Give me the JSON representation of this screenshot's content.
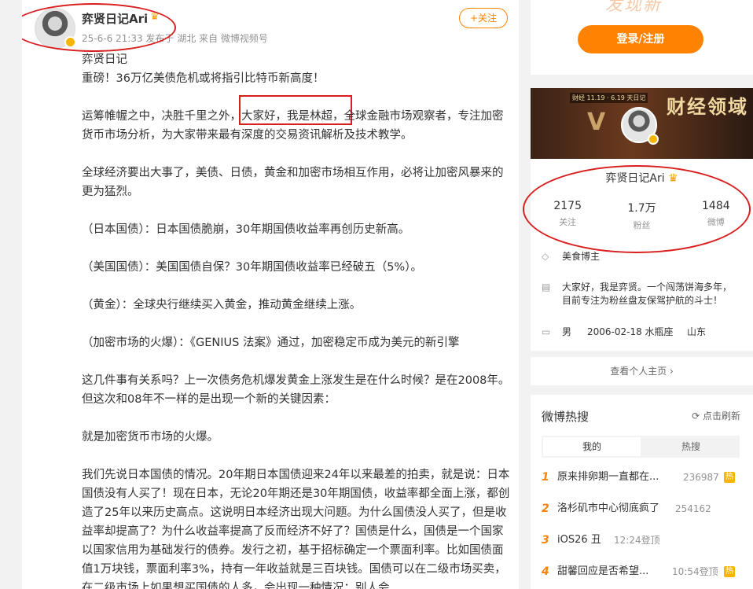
{
  "post": {
    "author": "弈贤日记Ari",
    "meta": "25-6-6 21:33  发布于 湖北  来自 微博视频号",
    "follow_label": "+关注",
    "paragraphs": [
      "弈贤日记",
      "重磅！36万亿美债危机或将指引比特币新高度！",
      "",
      "运筹帷幄之中，决胜千里之外，大家好，我是林超，全球金融市场观察者，专注加密货币市场分析，为大家带来最有深度的交易资讯解析及技术教学。",
      "",
      "全球经济要出大事了，美债、日债，黄金和加密市场相互作用，必将让加密风暴来的更为猛烈。",
      "",
      "（日本国债）：日本国债脆崩，30年期国债收益率再创历史新高。",
      "",
      "（美国国债）：美国国债自保？30年期国债收益率已经破五（5%）。",
      "",
      "（黄金）：全球央行继续买入黄金，推动黄金继续上涨。",
      "",
      "（加密市场的火爆）：《GENIUS 法案》通过，加密稳定币成为美元的新引擎",
      "",
      "这几件事有关系吗？上一次债务危机爆发黄金上涨发生是在什么时候？是在2008年。但这次和08年不一样的是出现一个新的关键因素：",
      "",
      "就是加密货币市场的火爆。",
      "",
      "我们先说日本国债的情况。20年期日本国债迎来24年以来最差的拍卖，就是说：日本国债没有人买了！现在日本，无论20年期还是30年期国债，收益率都全面上涨，都创造了25年以来历史高点。这说明日本经济出现大问题。为什么国债没人买了，但是收益率却提高了？为什么收益率提高了反而经济不好了？国债是什么，国债是一个国家以国家信用为基础发行的债券。发行之初，基于招标确定一个票面利率。比如国债面值1万块钱，票面利率3%，持有一年收益就是三百块钱。国债可以在二级市场买卖，在二级市场上如果想买国债的人多，会出现一种情况：别人会"
    ]
  },
  "login": {
    "deco": "发现新",
    "button_label": "登录/注册"
  },
  "profile": {
    "banner_title": "财经领域",
    "banner_chip": "财经 11.19 · 6.19 天日记",
    "banner_v": "V",
    "name": "弈贤日记Ari",
    "stats": [
      {
        "num": "2175",
        "label": "关注"
      },
      {
        "num": "1.7万",
        "label": "粉丝"
      },
      {
        "num": "1484",
        "label": "微博"
      }
    ],
    "badge": "美食博主",
    "bio": [
      "大家好，我是弈贤。一个闯荡饼海多年，",
      "目前专注为粉丝盘友保驾护航的斗士！"
    ],
    "gender": "男",
    "birthday": "2006-02-18 水瓶座",
    "location": "山东"
  },
  "homepage_link": "查看个人主页 ›",
  "hot": {
    "title": "微博热搜",
    "refresh_label": "点击刷新",
    "tabs": [
      "我的",
      "热搜"
    ],
    "items": [
      {
        "rank": "1",
        "text": "原来排卵期一直都在...",
        "count": "236987",
        "tag": "热"
      },
      {
        "rank": "2",
        "text": "洛杉矶市中心彻底疯了",
        "count": "254162",
        "tag": ""
      },
      {
        "rank": "3",
        "text": "iOS26 丑",
        "count": "12:24登顶",
        "tag": ""
      },
      {
        "rank": "4",
        "text": "甜馨回应是否希望...",
        "count": "10:54登顶",
        "tag": "热"
      }
    ]
  }
}
